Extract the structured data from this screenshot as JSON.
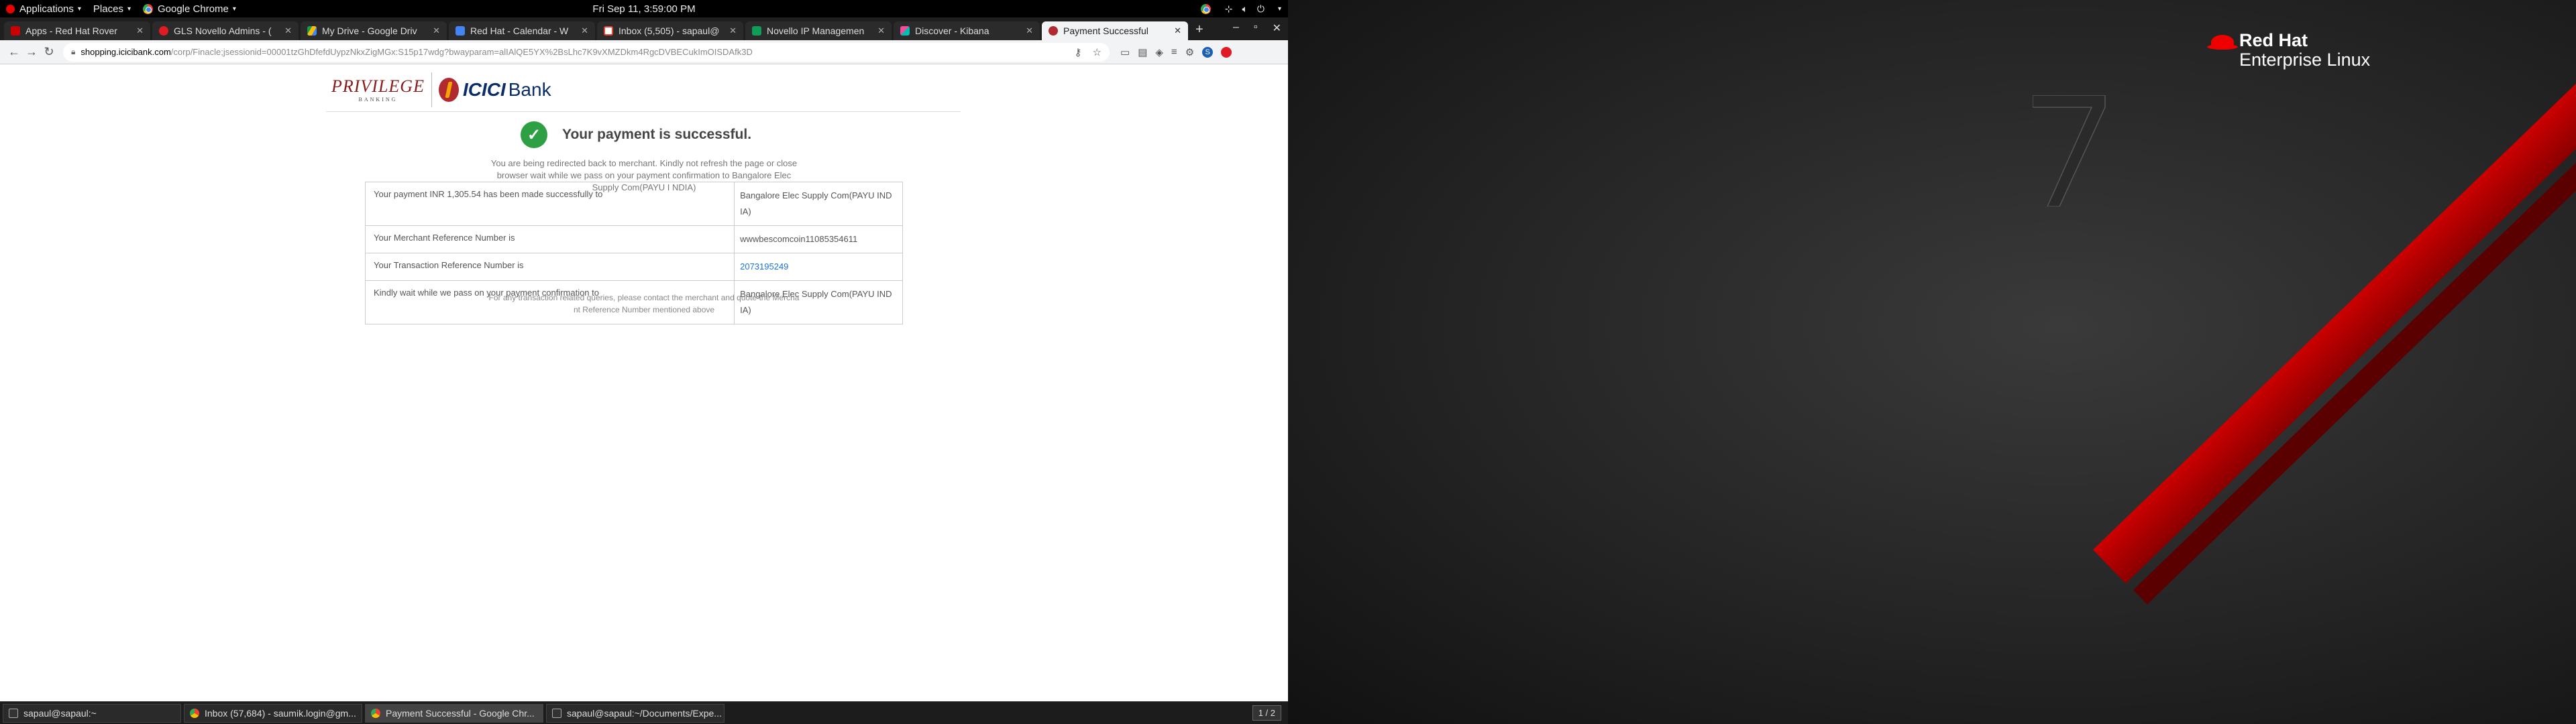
{
  "topbar": {
    "applications": "Applications",
    "places": "Places",
    "active_app": "Google Chrome",
    "clock": "Fri Sep 11,  3:59:00 PM"
  },
  "tabs": [
    {
      "title": "Apps - Red Hat Rover",
      "color": "#cc0000"
    },
    {
      "title": "GLS Novello Admins - (",
      "color": "#e01b24"
    },
    {
      "title": "My Drive - Google Driv",
      "color": "#fbbc05"
    },
    {
      "title": "Red Hat - Calendar - W",
      "color": "#4285f4"
    },
    {
      "title": "Inbox (5,505) - sapaul@",
      "color": "#ea4335"
    },
    {
      "title": "Novello IP Managemen",
      "color": "#0f9d58"
    },
    {
      "title": "Discover - Kibana",
      "color": "#00bfb3"
    },
    {
      "title": "Payment Successful",
      "color": "#b02a30"
    }
  ],
  "addressbar": {
    "host": "shopping.icicibank.com",
    "path": "/corp/Finacle;jsessionid=00001tzGhDfefdUypzNkxZigMGx:S15p17wdg?bwayparam=alIAlQE5YX%2BsLhc7K9vXMZDkm4RgcDVBECukImOISDAfk3D"
  },
  "bank": {
    "privilege": "PRIVILEGE",
    "privilege_sub": "BANKING",
    "icici": "ICICI",
    "bank": "Bank"
  },
  "status": {
    "check": "✓",
    "message": "Your payment is successful.",
    "redirect": "You are being redirected back to merchant. Kindly not refresh the page or close browser wait while we pass on your payment confirmation to Bangalore Elec Supply Com(PAYU I NDIA)"
  },
  "rows": [
    {
      "label": "Your payment INR 1,305.54 has been made successfully to",
      "value": "Bangalore Elec Supply Com(PAYU IND IA)"
    },
    {
      "label": "Your Merchant Reference Number is",
      "value": "wwwbescomcoin11085354611"
    },
    {
      "label": "Your Transaction Reference Number is",
      "value": "2073195249"
    },
    {
      "label": "Kindly wait while we pass on your payment confirmation to",
      "value": "Bangalore Elec Supply Com(PAYU IND IA)"
    }
  ],
  "footer": "For any transaction related queries, please contact the merchant and quote the Mercha nt Reference Number mentioned above",
  "taskbar": [
    {
      "title": "sapaul@sapaul:~"
    },
    {
      "title": "Inbox (57,684) - saumik.login@gm..."
    },
    {
      "title": "Payment Successful - Google Chr..."
    },
    {
      "title": "sapaul@sapaul:~/Documents/Expe..."
    }
  ],
  "workspace": "1 / 2",
  "desktop": {
    "brand1": "Red Hat",
    "brand2": "Enterprise Linux"
  },
  "profile_initial": "S"
}
